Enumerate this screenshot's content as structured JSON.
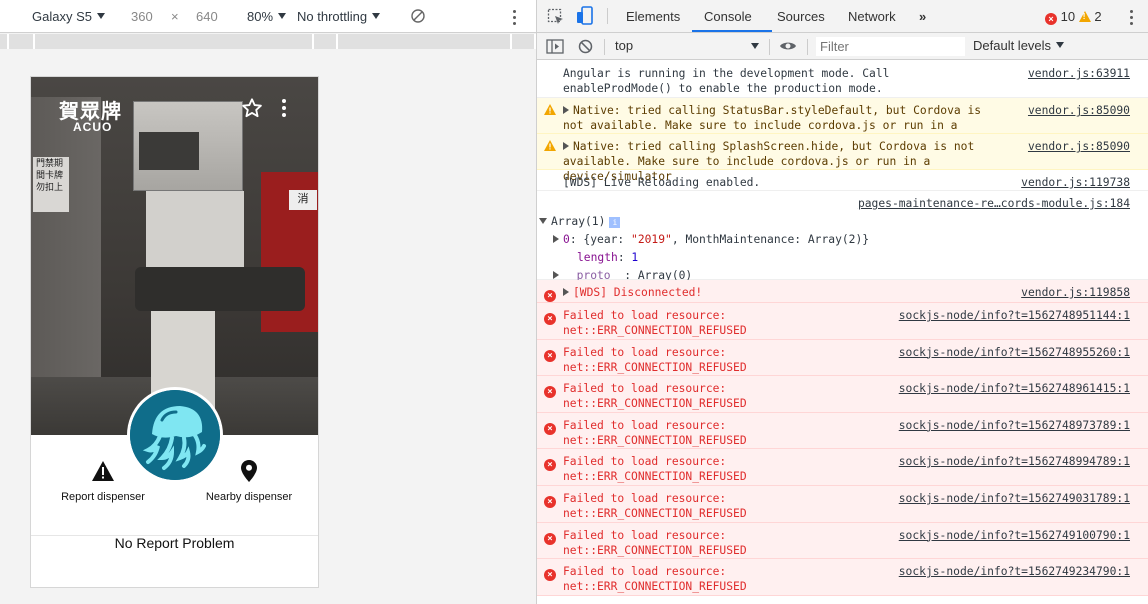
{
  "device_toolbar": {
    "device": "Galaxy S5",
    "width": "360",
    "times": "×",
    "height": "640",
    "zoom": "80%",
    "throttling": "No throttling"
  },
  "app": {
    "logo_cn": "賀眾牌",
    "logo_en": "ACUO",
    "sign_lines": [
      "門禁期",
      "間卡牌",
      "勿扣上"
    ],
    "cabinet_label": "消",
    "report_label": "Report dispenser",
    "nearby_label": "Nearby dispenser",
    "no_report": "No Report Problem"
  },
  "devtools": {
    "tabs": [
      "Elements",
      "Console",
      "Sources",
      "Network"
    ],
    "active_tab": "Console",
    "more_tabs": "»",
    "error_count": "10",
    "warning_count": "2",
    "context": "top",
    "filter_placeholder": "Filter",
    "levels": "Default levels"
  },
  "console": {
    "m1": {
      "text": "Angular is running in the development mode. Call enableProdMode() to enable the production mode.",
      "src": "vendor.js:63911"
    },
    "m2": {
      "text": "Native: tried calling StatusBar.styleDefault, but Cordova is not available. Make sure to include cordova.js or run in a device/simulator",
      "src": "vendor.js:85090"
    },
    "m3": {
      "text": "Native: tried calling SplashScreen.hide, but Cordova is not available. Make sure to include cordova.js or run in a device/simulator",
      "src": "vendor.js:85090"
    },
    "m4": {
      "text": "[WDS] Live Reloading enabled.",
      "src": "vendor.js:119738"
    },
    "m5": {
      "src": "pages-maintenance-re…cords-module.js:184",
      "array_head": "Array(1)",
      "array_badge": "i",
      "item0_key": "0",
      "item0_open": ": {year: ",
      "item0_year": "\"2019\"",
      "item0_rest": ", MonthMaintenance: Array(2)}",
      "length_key": "length",
      "length_val": "1",
      "proto_key": "__proto__",
      "proto_val": ": Array(0)"
    },
    "m6": {
      "text": "[WDS] Disconnected!",
      "src": "vendor.js:119858"
    },
    "errors": [
      {
        "text": "Failed to load resource: net::ERR_CONNECTION_REFUSED",
        "src": "sockjs-node/info?t=1562748951144:1"
      },
      {
        "text": "Failed to load resource: net::ERR_CONNECTION_REFUSED",
        "src": "sockjs-node/info?t=1562748955260:1"
      },
      {
        "text": "Failed to load resource: net::ERR_CONNECTION_REFUSED",
        "src": "sockjs-node/info?t=1562748961415:1"
      },
      {
        "text": "Failed to load resource: net::ERR_CONNECTION_REFUSED",
        "src": "sockjs-node/info?t=1562748973789:1"
      },
      {
        "text": "Failed to load resource: net::ERR_CONNECTION_REFUSED",
        "src": "sockjs-node/info?t=1562748994789:1"
      },
      {
        "text": "Failed to load resource: net::ERR_CONNECTION_REFUSED",
        "src": "sockjs-node/info?t=1562749031789:1"
      },
      {
        "text": "Failed to load resource: net::ERR_CONNECTION_REFUSED",
        "src": "sockjs-node/info?t=1562749100790:1"
      },
      {
        "text": "Failed to load resource: net::ERR_CONNECTION_REFUSED",
        "src": "sockjs-node/info?t=1562749234790:1"
      }
    ]
  }
}
